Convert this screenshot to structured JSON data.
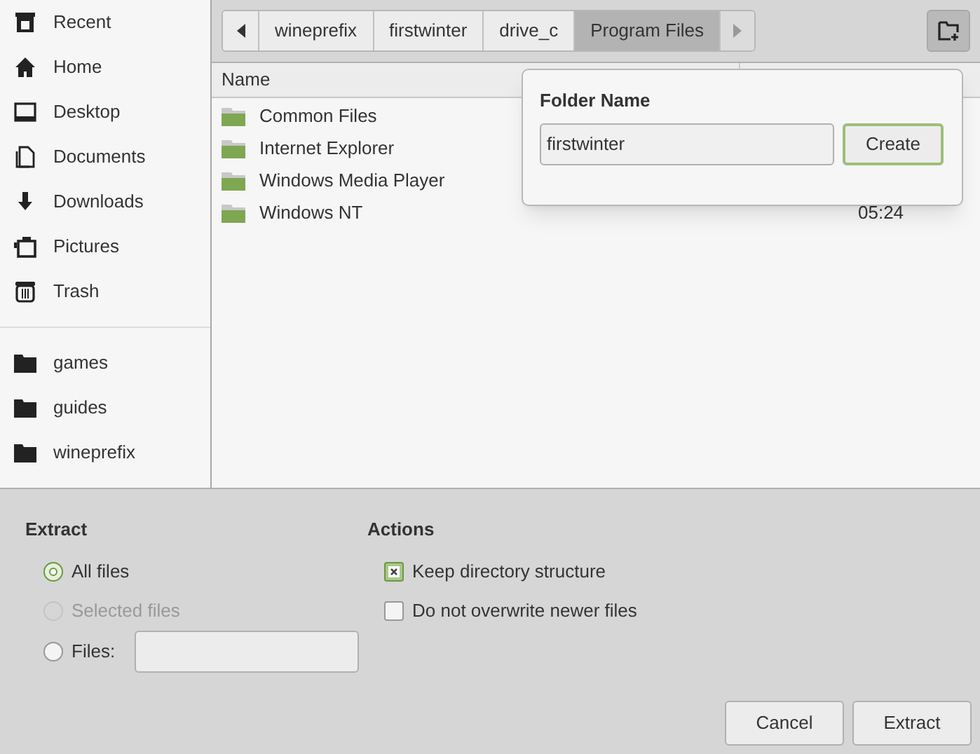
{
  "sidebar": {
    "places": [
      {
        "kind": "recent",
        "label": "Recent"
      },
      {
        "kind": "home",
        "label": "Home"
      },
      {
        "kind": "desktop",
        "label": "Desktop"
      },
      {
        "kind": "documents",
        "label": "Documents"
      },
      {
        "kind": "downloads",
        "label": "Downloads"
      },
      {
        "kind": "pictures",
        "label": "Pictures"
      },
      {
        "kind": "trash",
        "label": "Trash"
      }
    ],
    "bookmarks": [
      {
        "label": "games"
      },
      {
        "label": "guides"
      },
      {
        "label": "wineprefix"
      }
    ]
  },
  "pathbar": {
    "segments": [
      {
        "label": "wineprefix",
        "selected": false
      },
      {
        "label": "firstwinter",
        "selected": false
      },
      {
        "label": "drive_c",
        "selected": false
      },
      {
        "label": "Program Files",
        "selected": true
      }
    ]
  },
  "table": {
    "columns": [
      "Name"
    ],
    "rows": [
      {
        "name": "Common Files"
      },
      {
        "name": "Internet Explorer"
      },
      {
        "name": "Windows Media Player"
      },
      {
        "name": "Windows NT",
        "modified": "05:24"
      }
    ]
  },
  "popover": {
    "title": "Folder Name",
    "value": "firstwinter",
    "button": "Create"
  },
  "extract": {
    "title": "Extract",
    "options": [
      {
        "kind": "radio",
        "label": "All files",
        "selected": true,
        "disabled": false
      },
      {
        "kind": "radio",
        "label": "Selected files",
        "selected": false,
        "disabled": true
      },
      {
        "kind": "radio-with-field",
        "label": "Files:",
        "selected": false,
        "disabled": false
      }
    ]
  },
  "actions": {
    "title": "Actions",
    "options": [
      {
        "label": "Keep directory structure",
        "checked": true
      },
      {
        "label": "Do not overwrite newer files",
        "checked": false
      }
    ]
  },
  "buttons": [
    "Cancel",
    "Extract"
  ]
}
